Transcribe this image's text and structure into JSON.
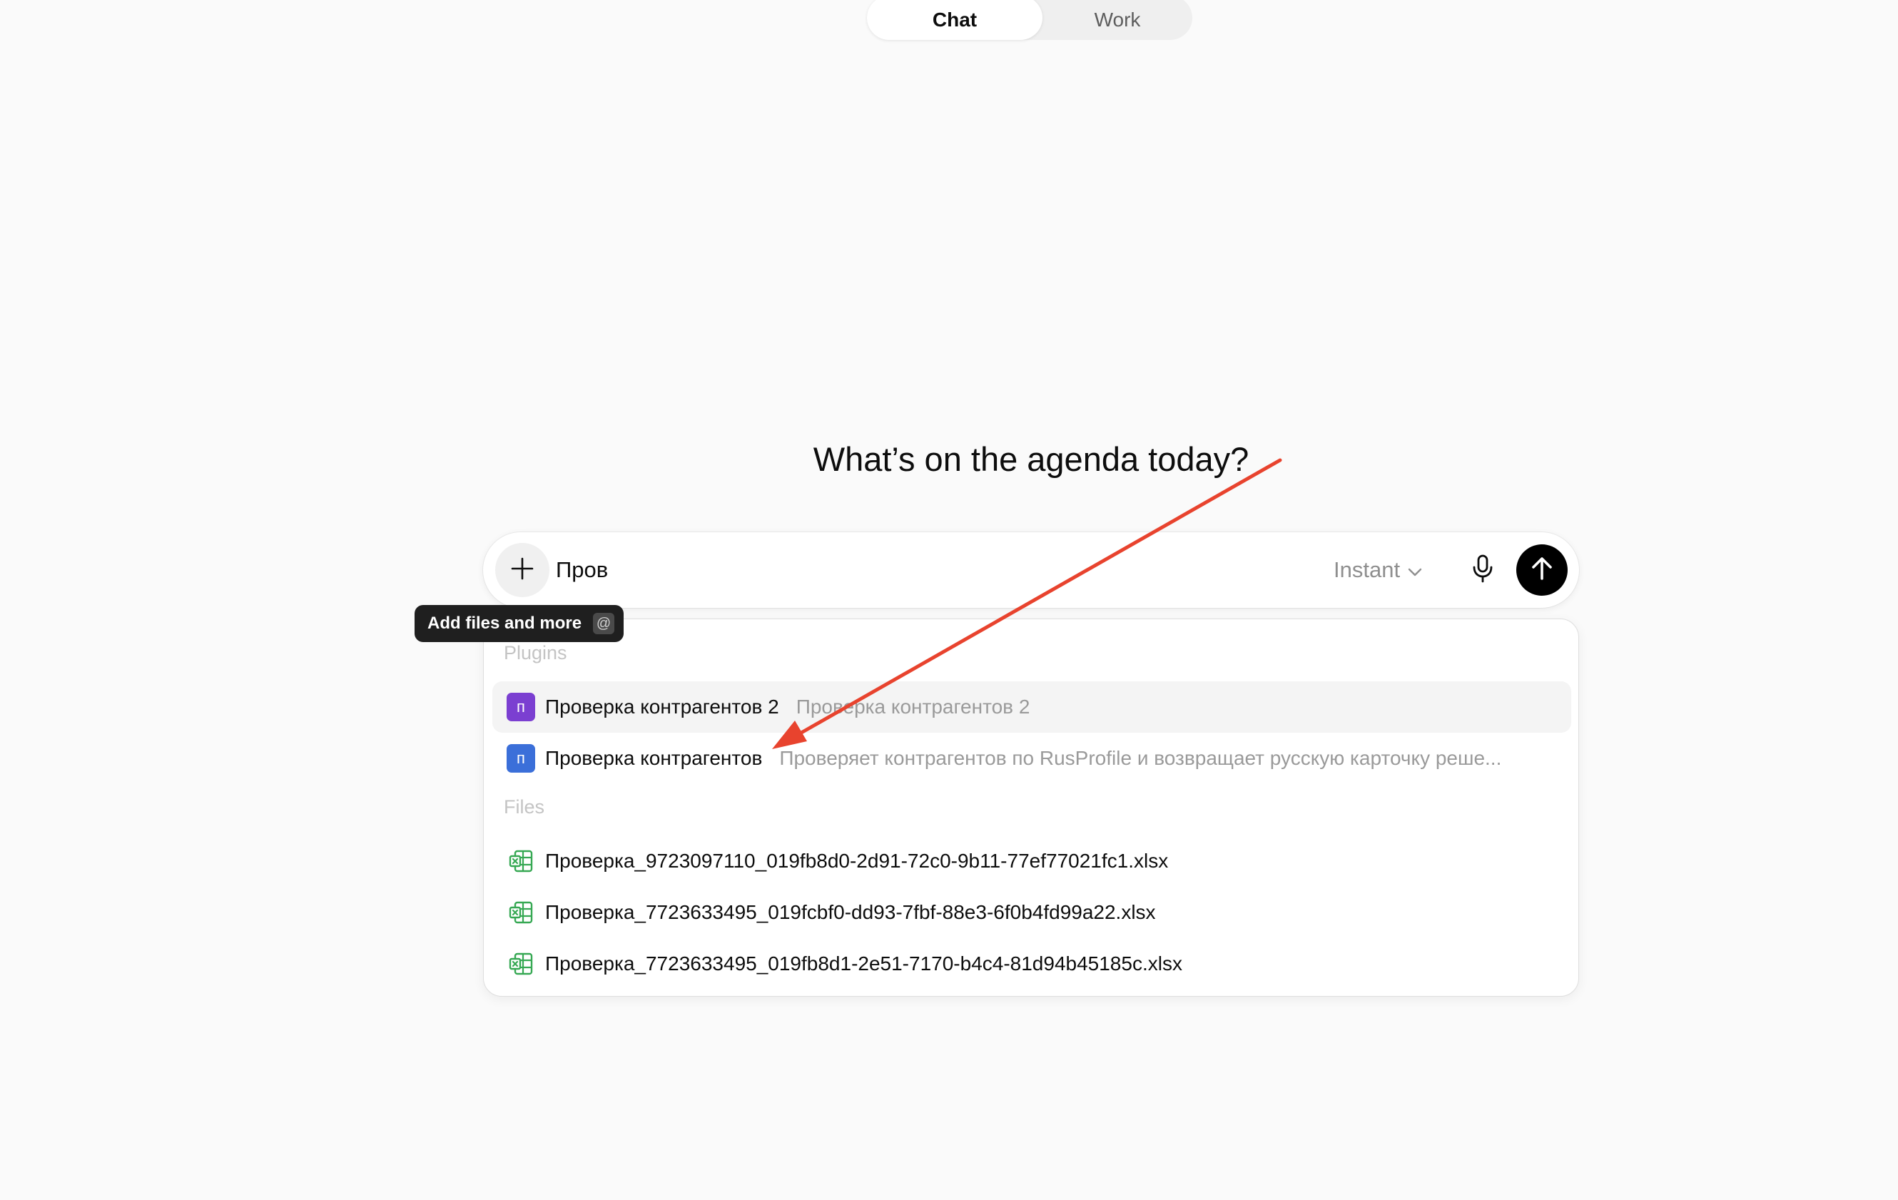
{
  "mode_switch": {
    "tabs": [
      {
        "label": "Chat",
        "active": true
      },
      {
        "label": "Work",
        "active": false
      }
    ]
  },
  "headline": "What’s on the agenda today?",
  "composer": {
    "input_value": "Пров",
    "model_label": "Instant",
    "plus_icon": "plus-icon",
    "mic_icon": "microphone-icon",
    "send_icon": "arrow-up-icon"
  },
  "tooltip": {
    "label": "Add files and more",
    "shortcut": "@"
  },
  "dropdown": {
    "plugins_heading": "Plugins",
    "plugins": [
      {
        "icon_letter": "п",
        "icon_color": "#7b3fd1",
        "title": "Проверка контрагентов 2",
        "description": "Проверка контрагентов 2",
        "highlighted": true
      },
      {
        "icon_letter": "п",
        "icon_color": "#3b6fd9",
        "title": "Проверка контрагентов",
        "description": "Проверяет контрагентов по RusProfile и возвращает русскую карточку реше...",
        "highlighted": false
      }
    ],
    "files_heading": "Files",
    "files": [
      {
        "name": "Проверка_9723097110_019fb8d0-2d91-72c0-9b11-77ef77021fc1.xlsx",
        "icon": "spreadsheet-icon"
      },
      {
        "name": "Проверка_7723633495_019fcbf0-dd93-7fbf-88e3-6f0b4fd99a22.xlsx",
        "icon": "spreadsheet-icon"
      },
      {
        "name": "Проверка_7723633495_019fb8d1-2e51-7170-b4c4-81d94b45185c.xlsx",
        "icon": "spreadsheet-icon"
      }
    ],
    "file_icon_color": "#36a853"
  },
  "annotation": {
    "arrow_color": "#e8432e"
  }
}
